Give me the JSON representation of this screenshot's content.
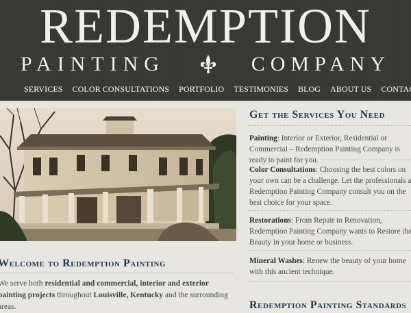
{
  "header": {
    "logo_main": "REDEMPTION",
    "logo_word1": "PAINTING",
    "logo_word2": "COMPANY",
    "logo_icon": "fleur-de-lis-icon"
  },
  "nav": {
    "items": [
      "SERVICES",
      "COLOR CONSULTATIONS",
      "PORTFOLIO",
      "TESTIMONIES",
      "BLOG",
      "ABOUT US",
      "CONTACT"
    ]
  },
  "hero": {
    "image": "victorian-house-photo"
  },
  "welcome": {
    "title": "Welcome to Redemption Painting",
    "text_1": "We serve both ",
    "text_bold_1": "residential and commercial, interior and exterior painting projects",
    "text_2": " throughout ",
    "text_bold_2": "Louisville, Kentucky",
    "text_3": " and the surrounding areas."
  },
  "services": {
    "title": "Get the Services You Need",
    "items": [
      {
        "name": "Painting",
        "desc": ": Interior or Exterior, Residential or Commercial – Redemption Painting Company is ready to paint for you."
      },
      {
        "name": "Color Consultations",
        "desc": ": Choosing the best colors on your own can be a challenge. Let the professionals at Redemption Painting Company consult you on the best choice for your space."
      },
      {
        "name": "Restorations",
        "desc": ": From Repair to Renovation, Redemption Painting Company wants to Restore the Beauty in your home or business."
      },
      {
        "name": "Mineral Washes",
        "desc": ": Renew the beauty of your home with this ancient technique."
      }
    ]
  },
  "standards": {
    "title": "Redemption Painting Standards"
  },
  "colors": {
    "header_bg": "#373733",
    "heading": "#1f3a55",
    "page_bg": "#e8e6e1"
  }
}
